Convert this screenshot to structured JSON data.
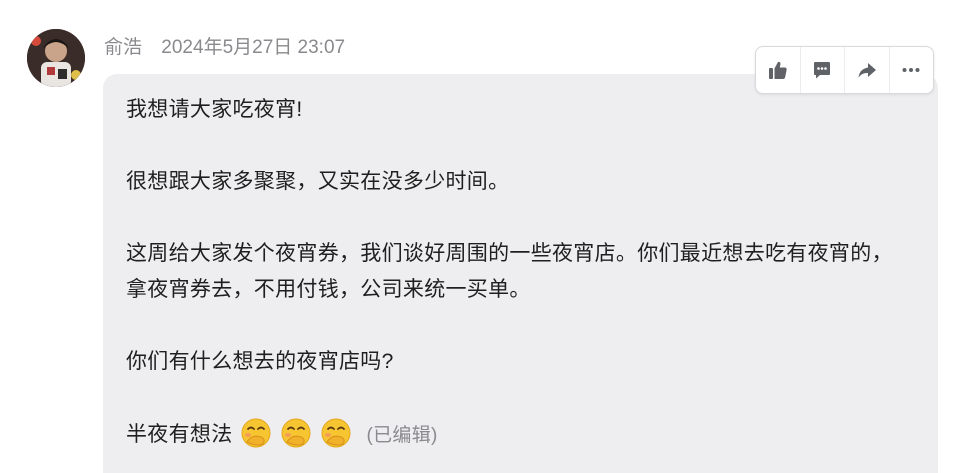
{
  "message": {
    "sender": "俞浩",
    "timestamp": "2024年5月27日 23:07",
    "paragraphs": [
      "我想请大家吃夜宵!",
      "很想跟大家多聚聚，又实在没多少时间。",
      "这周给大家发个夜宵券，我们谈好周围的一些夜宵店。你们最近想去吃有夜宵的，拿夜宵券去，不用付钱，公司来统一买单。",
      "你们有什么想去的夜宵店吗?",
      "半夜有想法"
    ],
    "emojis": [
      "hand-over-mouth-emoji",
      "hand-over-mouth-emoji",
      "hand-over-mouth-emoji"
    ],
    "edited_label": "(已编辑)"
  },
  "toolbar": {
    "actions": [
      "thumbs-up-icon",
      "comment-icon",
      "forward-icon",
      "more-icon"
    ]
  },
  "colors": {
    "bubble_bg": "#eeeef0",
    "meta_text": "#8a8a8e",
    "body_text": "#1f1f1f",
    "icon": "#5f6368"
  }
}
